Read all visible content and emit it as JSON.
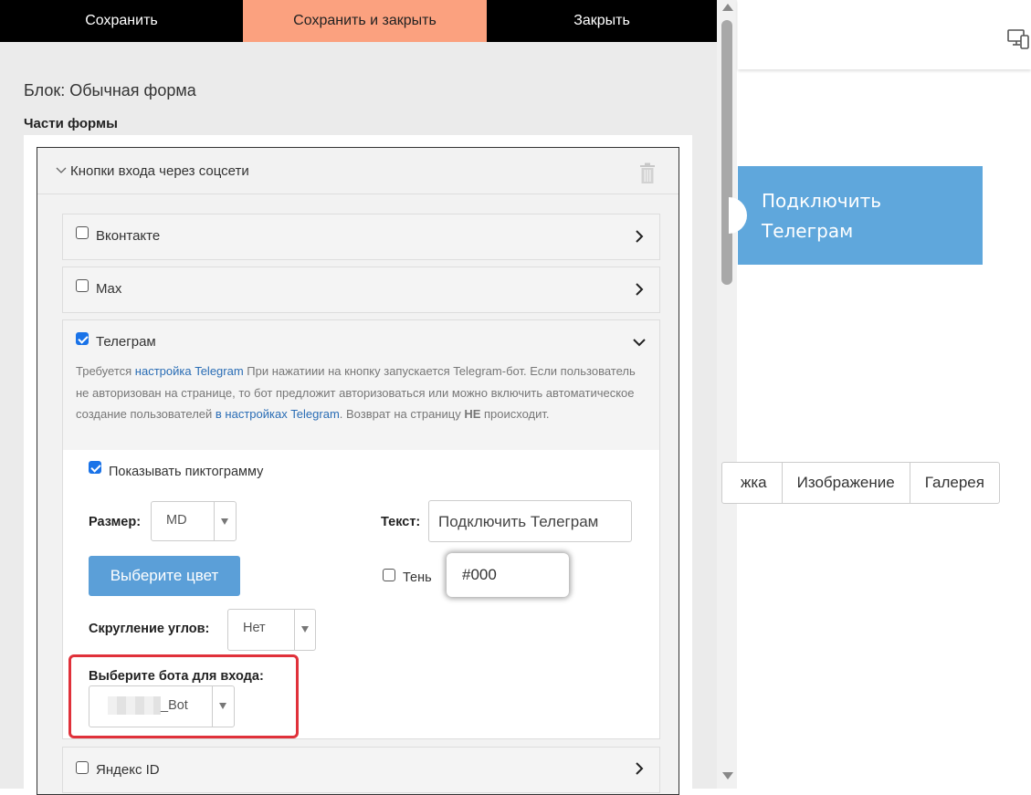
{
  "toolbar": {
    "save": "Сохранить",
    "save_close": "Сохранить и закрыть",
    "close": "Закрыть"
  },
  "editor": {
    "block_title": "Блок: Обычная форма",
    "parts_label": "Части формы",
    "group_title": "Кнопки входа через соцсети",
    "items": [
      {
        "label": "Вконтакте",
        "checked": false,
        "expanded": false
      },
      {
        "label": "Max",
        "checked": false,
        "expanded": false
      },
      {
        "label": "Телеграм",
        "checked": true,
        "expanded": true
      },
      {
        "label": "Яндекс ID",
        "checked": false,
        "expanded": false
      }
    ],
    "telegram": {
      "desc_part1": "Требуется ",
      "desc_link1": "настройка Telegram",
      "desc_part2": " При нажатиии на кнопку запускается Telegram-бот. Если пользователь не авторизован на странице, то бот предложит авторизоваться или можно включить автоматическое создание пользователей ",
      "desc_link2": "в настройках Telegram",
      "desc_part3": ". Возврат на страницу ",
      "desc_bold": "НЕ",
      "desc_part4": " происходит.",
      "show_icon_label": "Показывать пиктограмму",
      "show_icon_checked": true,
      "size_label": "Размер:",
      "size_value": "MD",
      "text_label": "Текст:",
      "text_value": "Подключить Телеграм",
      "pick_color_label": "Выберите цвет",
      "shadow_label": "Тень",
      "shadow_checked": false,
      "shadow_color_value": "#000",
      "rounding_label": "Скругление углов:",
      "rounding_value": "Нет",
      "bot_label": "Выберите бота для входа:",
      "bot_value": "_Bot"
    }
  },
  "preview": {
    "telegram_button_text": "Подключить Телеграм",
    "tabs": [
      "жка",
      "Изображение",
      "Галерея"
    ]
  },
  "colors": {
    "accent": "#fba17f",
    "toolbar": "#000000",
    "button_blue": "#5b9fd8",
    "preview_button": "#5fa7dc",
    "highlight": "#e0313a",
    "link": "#2a6db5"
  }
}
